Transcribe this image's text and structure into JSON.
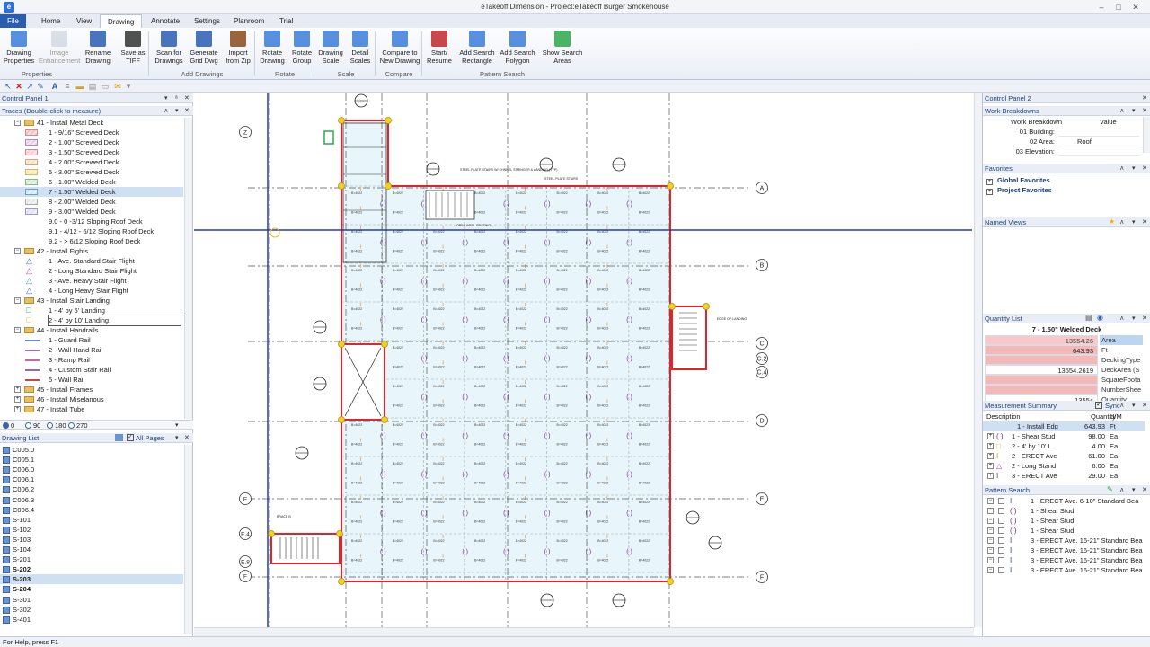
{
  "window": {
    "title": "eTakeoff Dimension - Project:eTakeoff Burger Smokehouse",
    "app_icon": "e"
  },
  "tabs": [
    "File",
    "Home",
    "View",
    "Drawing",
    "Annotate",
    "Settings",
    "Planroom",
    "Trial"
  ],
  "active_tab": "Drawing",
  "ribbon": {
    "buttons": [
      {
        "label1": "Drawing",
        "label2": "Properties",
        "icon": "drawing-properties-icon",
        "disabled": false
      },
      {
        "label1": "Image",
        "label2": "Enhancement",
        "icon": "image-enhancement-icon",
        "disabled": true
      },
      {
        "label1": "Rename",
        "label2": "Drawing",
        "icon": "rename-icon",
        "disabled": false
      },
      {
        "label1": "Save as",
        "label2": "TIFF",
        "icon": "tiff-icon",
        "disabled": false
      },
      {
        "label1": "Scan for",
        "label2": "Drawings",
        "icon": "scan-icon",
        "disabled": false
      },
      {
        "label1": "Generate",
        "label2": "Grid Dwg",
        "icon": "grid-icon",
        "disabled": false
      },
      {
        "label1": "Import",
        "label2": "from Zip",
        "icon": "zip-icon",
        "disabled": false
      },
      {
        "label1": "Rotate",
        "label2": "Drawing",
        "icon": "rotate-icon",
        "disabled": false
      },
      {
        "label1": "Rotate",
        "label2": "Group",
        "icon": "rotate-group-icon",
        "disabled": false
      },
      {
        "label1": "Drawing",
        "label2": "Scale",
        "icon": "scale-icon",
        "disabled": false
      },
      {
        "label1": "Detail",
        "label2": "Scales",
        "icon": "detail-scales-icon",
        "disabled": false
      },
      {
        "label1": "Compare to",
        "label2": "New Drawing",
        "icon": "compare-icon",
        "disabled": false
      },
      {
        "label1": "Start/",
        "label2": "Resume",
        "icon": "start-icon",
        "disabled": false
      },
      {
        "label1": "Add Search",
        "label2": "Rectangle",
        "icon": "search-rect-icon",
        "disabled": false
      },
      {
        "label1": "Add Search",
        "label2": "Polygon",
        "icon": "search-polygon-icon",
        "disabled": false
      },
      {
        "label1": "Show Search",
        "label2": "Areas",
        "icon": "search-areas-icon",
        "disabled": false
      }
    ],
    "groups": [
      "Properties",
      "Add Drawings",
      "Rotate",
      "Scale",
      "Compare",
      "Pattern Search"
    ]
  },
  "control_panel_1": {
    "title": "Control Panel 1",
    "traces_title": "Traces (Double-click to measure)",
    "traces": [
      {
        "text": "41 - Install Metal Deck",
        "level": 0,
        "type": "group",
        "exp": "−"
      },
      {
        "text": "1 - 9/16\"  Screwed Deck",
        "level": 1,
        "swatch": "#f4c2c2",
        "border": "#d08a8a"
      },
      {
        "text": "2 - 1.00\"  Screwed Deck",
        "level": 1,
        "swatch": "#e7d2ea",
        "border": "#b48ab8"
      },
      {
        "text": "3 - 1.50\"  Screwed Deck",
        "level": 1,
        "swatch": "#f7d0da",
        "border": "#d3899c"
      },
      {
        "text": "4 - 2.00\"  Screwed Deck",
        "level": 1,
        "swatch": "#f6e0c8",
        "border": "#d3a87a"
      },
      {
        "text": "5 - 3.00\"  Screwed Deck",
        "level": 1,
        "swatch": "#fbe8b8",
        "border": "#d8b55a"
      },
      {
        "text": "6 - 1.00\"  Welded Deck",
        "level": 1,
        "swatch": "#d3ecd3",
        "border": "#84b884"
      },
      {
        "text": "7 - 1.50\"  Welded Deck",
        "level": 1,
        "swatch": "#cfe6f3",
        "border": "#6a9fc8",
        "selected": true
      },
      {
        "text": "8 - 2.00\"  Welded Deck",
        "level": 1,
        "swatch": "#e8e8e8",
        "border": "#aaaaaa"
      },
      {
        "text": "9 - 3.00\"  Welded Deck",
        "level": 1,
        "swatch": "#e0e0f4",
        "border": "#9a9ad0"
      },
      {
        "text": "9.0 - 0 -3/12 Sloping Roof Deck",
        "level": 1,
        "swatch": ""
      },
      {
        "text": "9.1 - 4/12 - 6/12 Sloping Roof Deck",
        "level": 1,
        "swatch": ""
      },
      {
        "text": "9.2 - > 6/12 Sloping Roof Deck",
        "level": 1,
        "swatch": ""
      },
      {
        "text": "42 - Install Fights",
        "level": 0,
        "type": "group",
        "exp": "−"
      },
      {
        "text": "1 - Ave. Standard Stair Flight",
        "level": 1,
        "glyph": "△",
        "gcolor": "#3a63c8"
      },
      {
        "text": "2 - Long Standard Stair Flight",
        "level": 1,
        "glyph": "△",
        "gcolor": "#c03ac0"
      },
      {
        "text": "3 -  Ave. Heavy Stair Flight",
        "level": 1,
        "glyph": "△",
        "gcolor": "#3a9ac8"
      },
      {
        "text": "4 - Long Heavy Stair Flight",
        "level": 1,
        "glyph": "△",
        "gcolor": "#3a63c8"
      },
      {
        "text": "43 - Install Stair Landing",
        "level": 0,
        "type": "group",
        "exp": "−"
      },
      {
        "text": "1 - 4' by 5' Landing",
        "level": 1,
        "glyph": "□",
        "gcolor": "#2aa84a"
      },
      {
        "text": "2 - 4' by 10' Landing",
        "level": 1,
        "glyph": "□",
        "gcolor": "#d8c020",
        "outlined": true
      },
      {
        "text": "44 - Install Handrails",
        "level": 0,
        "type": "group",
        "exp": "−"
      },
      {
        "text": "1 - Guard Rail",
        "level": 1,
        "line": "#6a8ad8"
      },
      {
        "text": "2 - Wall Hand Rail",
        "level": 1,
        "line": "#a56ac8"
      },
      {
        "text": "3 - Ramp Rail",
        "level": 1,
        "line": "#c86aa0"
      },
      {
        "text": "4 - Custom Stair Rail",
        "level": 1,
        "line": "#8a6ac8"
      },
      {
        "text": "5 - Wall Rail",
        "level": 1,
        "line": "#c04a4a"
      },
      {
        "text": "45 - Install Frames",
        "level": 0,
        "type": "group",
        "exp": "+"
      },
      {
        "text": "46 - Install Miselanous",
        "level": 0,
        "type": "group",
        "exp": "+"
      },
      {
        "text": "47 - Install Tube",
        "level": 0,
        "type": "group",
        "exp": "+"
      }
    ],
    "rotation_options": [
      "0",
      "90",
      "180",
      "270"
    ],
    "drawing_list_title": "Drawing List",
    "all_pages_label": "All Pages",
    "drawings": [
      {
        "name": "C005.0"
      },
      {
        "name": "C005.1"
      },
      {
        "name": "C006.0"
      },
      {
        "name": "C006.1"
      },
      {
        "name": "C006.2"
      },
      {
        "name": "C006.3"
      },
      {
        "name": "C006.4"
      },
      {
        "name": "S-101"
      },
      {
        "name": "S-102"
      },
      {
        "name": "S-103"
      },
      {
        "name": "S-104"
      },
      {
        "name": "S-201"
      },
      {
        "name": "S-202",
        "bold": true
      },
      {
        "name": "S-203",
        "bold": true,
        "selected": true
      },
      {
        "name": "S-204",
        "bold": true
      },
      {
        "name": "S-301"
      },
      {
        "name": "S-302"
      },
      {
        "name": "S-401"
      }
    ]
  },
  "drawing": {
    "grid_right": [
      "A",
      "B",
      "C",
      "C.2",
      "C.4",
      "D",
      "E",
      "F"
    ],
    "grid_left": [
      "Z",
      "E",
      "E.4",
      "E.8",
      "F"
    ],
    "notes": [
      "STEEL PLATE STAIRS W/ CHNNEL STRINGER & LANDING (TYP)",
      "OPEN WELL GRATING",
      "EDGE OF LANDING",
      "BRACE B",
      "STEEL PLATE STAIRS"
    ],
    "deck_label": "B=4022"
  },
  "control_panel_2": {
    "title": "Control Panel 2",
    "work_breakdowns": {
      "title": "Work Breakdowns",
      "col1": "Work Breakdown",
      "col2": "Value",
      "rows": [
        {
          "k": "01 Building:",
          "v": ""
        },
        {
          "k": "02 Area:",
          "v": "Roof"
        },
        {
          "k": "03 Elevation:",
          "v": ""
        }
      ]
    },
    "favorites": {
      "title": "Favorites",
      "items": [
        "Global Favorites",
        "Project Favorites"
      ]
    },
    "named_views": {
      "title": "Named Views"
    },
    "quantity_list": {
      "title": "Quantity List",
      "item": "7 - 1.50\"  Welded Deck",
      "rows": [
        {
          "v": "13554.26",
          "u": "Area",
          "hl": true
        },
        {
          "v": "643.93",
          "u": "Ft",
          "hl": false,
          "red": true
        },
        {
          "v": "",
          "u": "DeckingType",
          "hl": false,
          "red": true
        },
        {
          "v": "13554.2619",
          "u": "DeckArea (S",
          "hl": false
        },
        {
          "v": "",
          "u": "SquareFoota",
          "hl": false,
          "red": true
        },
        {
          "v": "",
          "u": "NumberShee",
          "hl": false,
          "red": true
        },
        {
          "v": "13554",
          "u": "Quantity",
          "hl": false
        }
      ]
    },
    "measurement_summary": {
      "title": "Measurement Summary",
      "sync_label": "Sync",
      "cols": [
        "Description",
        "Quantity",
        "U/M"
      ],
      "rows": [
        {
          "d": "1 - Install Edg",
          "q": "643.93",
          "u": "Ft",
          "sel": true
        },
        {
          "d": "1 - Shear Stud",
          "q": "98.00",
          "u": "Ea",
          "g": "( )",
          "gc": "#7a2a8a"
        },
        {
          "d": "2 - 4' by 10' L",
          "q": "4.00",
          "u": "Ea",
          "g": "□",
          "gc": "#d8c020"
        },
        {
          "d": "2 - ERECT Ave",
          "q": "61.00",
          "u": "Ea",
          "g": "I",
          "gc": "#d8a020"
        },
        {
          "d": "2 - Long Stand",
          "q": "6.00",
          "u": "Ea",
          "g": "△",
          "gc": "#c03ac0"
        },
        {
          "d": "3 - ERECT Ave",
          "q": "29.00",
          "u": "Ea",
          "g": "I",
          "gc": "#7a2a8a"
        }
      ]
    },
    "pattern_search": {
      "title": "Pattern Search",
      "rows": [
        {
          "t": "1 - ERECT Ave. 6-10\" Standard Bea",
          "g": "I"
        },
        {
          "t": "1 - Shear Stud",
          "g": "( )"
        },
        {
          "t": "1 - Shear Stud",
          "g": "( )"
        },
        {
          "t": "1 - Shear Stud",
          "g": "( )"
        },
        {
          "t": "3 - ERECT Ave. 16-21\" Standard Bea",
          "g": "I"
        },
        {
          "t": "3 - ERECT Ave. 16-21\" Standard Bea",
          "g": "I"
        },
        {
          "t": "3 - ERECT Ave. 16-21\" Standard Bea",
          "g": "I"
        },
        {
          "t": "3 - ERECT Ave. 16-21\" Standard Bea",
          "g": "I"
        }
      ]
    }
  },
  "status": "For Help, press F1",
  "colors": {
    "accent": "#2a5db0",
    "deck_outline": "#e0242c",
    "deck_fill": "#e8f6fb",
    "crosshair": "#2a3aa8",
    "vertex": "#f2d21e"
  }
}
